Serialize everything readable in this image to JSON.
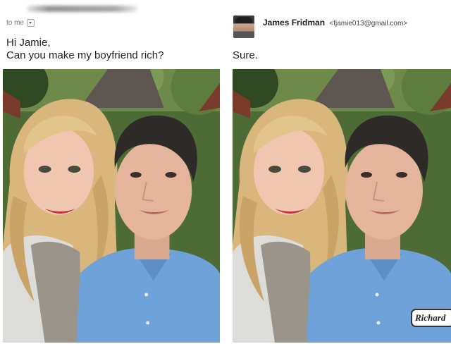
{
  "left": {
    "to_label": "to me",
    "message_line1": "Hi Jamie,",
    "message_line2": "Can you make my boyfriend rich?"
  },
  "right": {
    "sender_name": "James Fridman",
    "sender_email": "<fjamie013@gmail.com>",
    "reply": "Sure.",
    "name_tag": "Richard"
  },
  "icons": [
    "dropdown-arrow-icon",
    "sender-avatar"
  ],
  "colors": {
    "shirt_blue": "#6fa2d8",
    "foliage_green": "#3f5a2c"
  }
}
